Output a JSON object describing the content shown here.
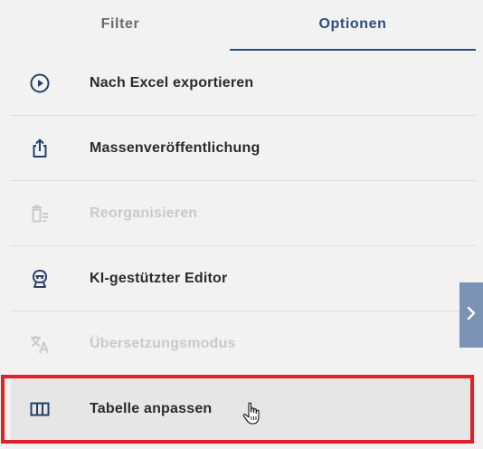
{
  "tabs": [
    {
      "label": "Filter",
      "active": false
    },
    {
      "label": "Optionen",
      "active": true
    }
  ],
  "menu": {
    "items": [
      {
        "label": "Nach Excel exportieren",
        "icon": "play-circle-icon",
        "disabled": false
      },
      {
        "label": "Massenveröffentlichung",
        "icon": "share-upload-icon",
        "disabled": false
      },
      {
        "label": "Reorganisieren",
        "icon": "reorganize-icon",
        "disabled": true
      },
      {
        "label": "KI-gestützter Editor",
        "icon": "robot-icon",
        "disabled": false
      },
      {
        "label": "Übersetzungsmodus",
        "icon": "translate-icon",
        "disabled": true
      },
      {
        "label": "Tabelle anpassen",
        "icon": "table-columns-icon",
        "disabled": false,
        "selected": true
      }
    ]
  },
  "colors": {
    "accent": "#2a4e7c",
    "icon": "#23406a",
    "disabled": "#c9c9c9",
    "highlight": "#e0202a",
    "handle": "#7a93b4"
  },
  "side_handle": {
    "icon": "chevron-right-icon"
  }
}
